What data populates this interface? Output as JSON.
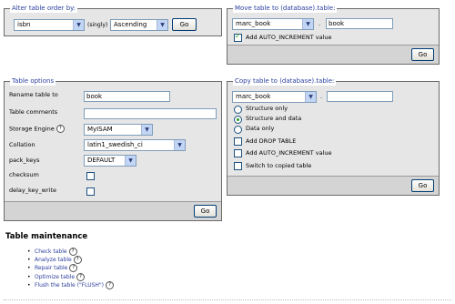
{
  "order": {
    "legend": "Alter table order by:",
    "column_value": "isbn",
    "singly_label": "(singly)",
    "direction_value": "Ascending",
    "go": "Go"
  },
  "move": {
    "legend": "Move table to (database).table:",
    "db_value": "marc_book",
    "sep": ".",
    "table_value": "book",
    "auto_increment_label": "Add AUTO_INCREMENT value",
    "auto_increment_checked": true,
    "go": "Go"
  },
  "options": {
    "legend": "Table options",
    "rename_label": "Rename table to",
    "rename_value": "book",
    "comments_label": "Table comments",
    "comments_value": "",
    "engine_label": "Storage Engine",
    "engine_value": "MyISAM",
    "collation_label": "Collation",
    "collation_value": "latin1_swedish_ci",
    "pack_keys_label": "pack_keys",
    "pack_keys_value": "DEFAULT",
    "checksum_label": "checksum",
    "delay_key_write_label": "delay_key_write",
    "go": "Go"
  },
  "copy": {
    "legend": "Copy table to (database).table:",
    "db_value": "marc_book",
    "sep": ".",
    "table_value": "",
    "structure_only": "Structure only",
    "structure_and_data": "Structure and data",
    "data_only": "Data only",
    "add_drop_table": "Add DROP TABLE",
    "auto_increment_label": "Add AUTO_INCREMENT value",
    "switch_label": "Switch to copied table",
    "selected_option": "structure_and_data",
    "go": "Go"
  },
  "maintenance": {
    "title": "Table maintenance",
    "items": [
      {
        "label": "Check table"
      },
      {
        "label": "Analyze table"
      },
      {
        "label": "Repair table"
      },
      {
        "label": "Optimize table"
      },
      {
        "label": "Flush the table (\"FLUSH\")"
      }
    ]
  }
}
